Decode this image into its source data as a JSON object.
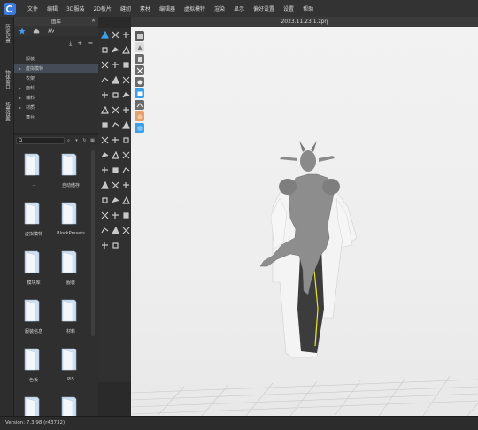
{
  "menu": [
    "文件",
    "编辑",
    "3D服装",
    "2D板片",
    "缝纫",
    "素材",
    "编辑器",
    "虚拟模特",
    "渲染",
    "显示",
    "偏好设置",
    "设置",
    "帮助"
  ],
  "left_tabs": [
    "历史记录",
    "物体窗口",
    "场景设置"
  ],
  "library": {
    "title": "图库",
    "close_icon": "✕",
    "tabs": [
      "star-icon",
      "library-icon",
      "cloud-icon"
    ],
    "tree": [
      {
        "label": "服装",
        "expanded": false,
        "selected": false
      },
      {
        "label": "虚拟模特",
        "expanded": true,
        "selected": true
      },
      {
        "label": "衣架",
        "expanded": false,
        "selected": false
      },
      {
        "label": "面料",
        "expanded": true,
        "selected": false
      },
      {
        "label": "辅料",
        "expanded": true,
        "selected": false
      },
      {
        "label": "材质",
        "expanded": true,
        "selected": false
      },
      {
        "label": "舞台",
        "expanded": false,
        "selected": false
      }
    ],
    "folders": [
      {
        "label": ".."
      },
      {
        "label": "自动储存"
      },
      {
        "label": "虚拟模特"
      },
      {
        "label": "BlockPresets"
      },
      {
        "label": "模块库"
      },
      {
        "label": "服装"
      },
      {
        "label": "服装信息"
      },
      {
        "label": "材料"
      },
      {
        "label": "色板"
      },
      {
        "label": "PIS"
      },
      {
        "label": ""
      },
      {
        "label": ""
      }
    ]
  },
  "viewport": {
    "file_title": "2023.11.23.1.zprj"
  },
  "status": {
    "version": "Version: 7.3.98 (r43732)"
  },
  "colors": {
    "accent": "#3d7bd9",
    "panel": "#2f2f2f",
    "viewport_bg": "#efefef"
  }
}
